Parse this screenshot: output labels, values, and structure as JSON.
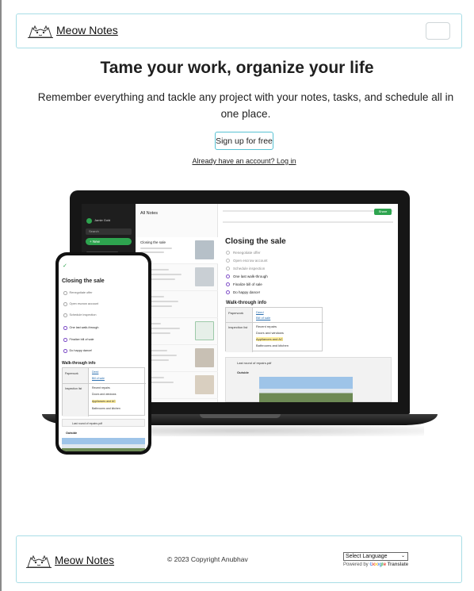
{
  "header": {
    "brand_name": "Meow Notes",
    "menu_label": ""
  },
  "hero": {
    "title": "Tame your work, organize your life",
    "subtitle": "Remember everything and tackle any project with your notes, tasks, and schedule all in one place.",
    "signup_label": "Sign up for free",
    "login_link": "Already have an account? Log in"
  },
  "laptop_app": {
    "user_name": "Jamie Gold",
    "search_label": "Search",
    "new_label": "+ New",
    "notes_heading": "All Notes",
    "note_items": [
      {
        "title": "Closing the sale"
      },
      {
        "title": ""
      },
      {
        "title": ""
      },
      {
        "title": ""
      },
      {
        "title": ""
      }
    ],
    "share_label": "Share",
    "note_title": "Closing the sale",
    "tasks": [
      {
        "text": "Renegotiate offer",
        "done": true
      },
      {
        "text": "Open escrow account",
        "done": true
      },
      {
        "text": "Schedule inspection",
        "done": true
      },
      {
        "text": "One last walk-through",
        "done": false
      },
      {
        "text": "Finalize bill of sale",
        "done": false
      },
      {
        "text": "Do happy dance!",
        "done": false
      }
    ],
    "section_title": "Walk-through info",
    "table": {
      "paperwork_label": "Paperwork",
      "paperwork_items": [
        "Deed",
        "Bill of sale"
      ],
      "inspection_label": "Inspection list",
      "inspection_items": [
        "Recent repairs",
        "Doors and windows",
        "Appliances and AC",
        "Bathrooms and kitchen"
      ]
    },
    "attachment_name": "Last round of repairs.pdf",
    "attachment_caption": "Outside"
  },
  "phone_app": {
    "note_title": "Closing the sale",
    "tasks": [
      {
        "text": "Renegotiate offer",
        "done": true
      },
      {
        "text": "Open escrow account",
        "done": true
      },
      {
        "text": "Schedule inspection",
        "done": true
      },
      {
        "text": "One last walk-through",
        "done": false
      },
      {
        "text": "Finalize bill of sale",
        "done": false
      },
      {
        "text": "Do happy dance!",
        "done": false
      }
    ],
    "section_title": "Walk-through info",
    "table": {
      "paperwork_label": "Paperwork",
      "paperwork_items": [
        "Deed",
        "Bill of sale"
      ],
      "inspection_label": "Inspection list",
      "inspection_items": [
        "Recent repairs",
        "Doors and windows",
        "Appliances and AC",
        "Bathrooms and kitchen"
      ]
    },
    "attachment_name": "Last round of repairs.pdf",
    "attachment_caption": "Outside"
  },
  "footer": {
    "brand_name": "Meow Notes",
    "copyright": "© 2023 Copyright Anubhav",
    "language_select": "Select Language",
    "powered_by": "Powered by",
    "google": "Google",
    "translate": "Translate"
  },
  "colors": {
    "border_accent": "#a8dde6",
    "button_border": "#58c2d3",
    "app_green": "#2ea44f"
  }
}
